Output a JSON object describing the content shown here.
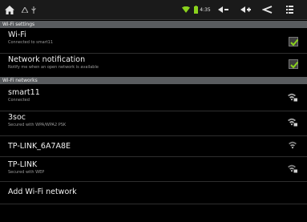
{
  "status_bar": {
    "time": "4:35",
    "icons": [
      "home-icon",
      "notification-icon",
      "usb-icon",
      "wifi-signal-icon",
      "battery-icon",
      "volume-down-icon",
      "volume-up-icon",
      "back-icon",
      "menu-icon"
    ]
  },
  "colors": {
    "checkbox_green": "#8ad21d",
    "section_header": "#595c5f"
  },
  "wifi_settings": {
    "header": "Wi-Fi settings",
    "wifi": {
      "title": "Wi-Fi",
      "summary": "Connected to smart11",
      "checked": true
    },
    "notification": {
      "title": "Network notification",
      "summary": "Notify me when an open network is available",
      "checked": true
    }
  },
  "wifi_networks": {
    "header": "Wi-Fi networks",
    "networks": [
      {
        "name": "smart11",
        "status": "Connected",
        "secured": true
      },
      {
        "name": "3soc",
        "status": "Secured with WPA/WPA2 PSK",
        "secured": true
      },
      {
        "name": "TP-LINK_6A7A8E",
        "status": "",
        "secured": false
      },
      {
        "name": "TP-LINK",
        "status": "Secured with WEP",
        "secured": true
      }
    ],
    "add_network": "Add Wi-Fi network"
  }
}
